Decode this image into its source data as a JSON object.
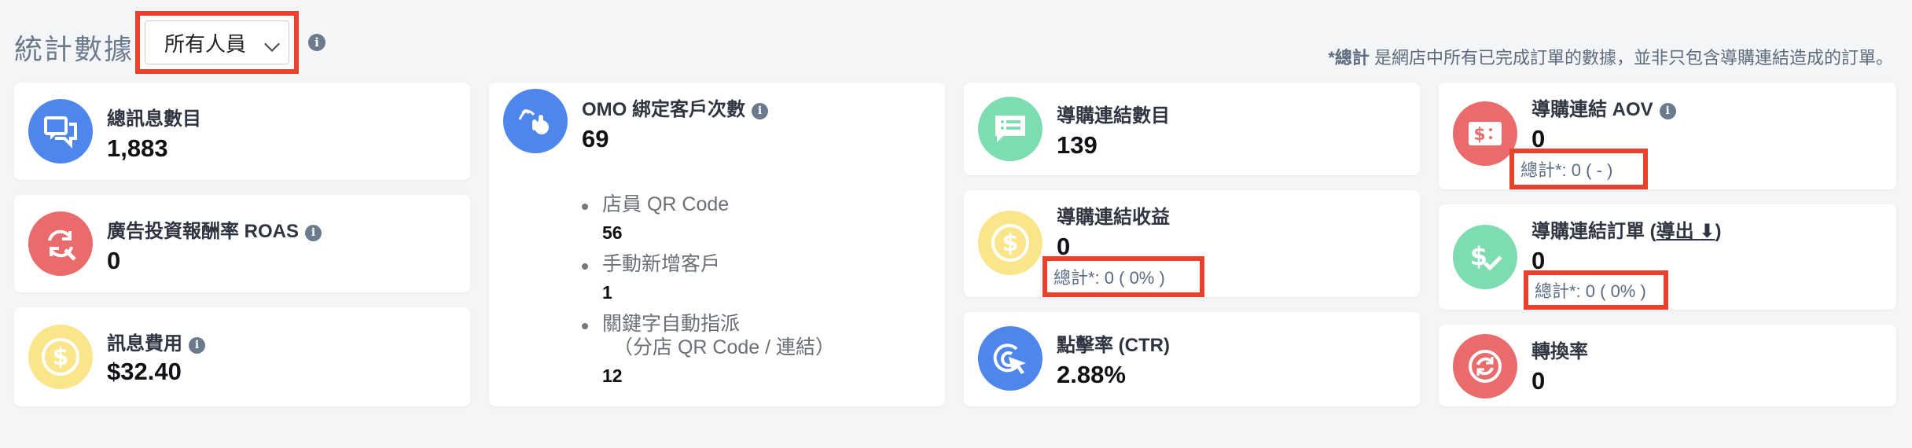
{
  "header": {
    "title": "統計數據",
    "staff_select_value": "所有人員",
    "note_bold": "*總計",
    "note_text": " 是網店中所有已完成訂單的數據，並非只包含導購連結造成的訂單。"
  },
  "cards": {
    "messages": {
      "title": "總訊息數目",
      "value": "1,883",
      "icon": "chat-bubbles-icon",
      "color": "#4f86ec"
    },
    "roas": {
      "title": "廣告投資報酬率 ROAS",
      "value": "0",
      "icon": "refresh-search-icon",
      "color": "#ea6b6b"
    },
    "message_cost": {
      "title": "訊息費用",
      "value": "$32.40",
      "icon": "dollar-icon",
      "color": "#fbe58a"
    },
    "omo": {
      "title": "OMO 綁定客戶次數",
      "value": "69",
      "icon": "hand-wave-icon",
      "color": "#4f86ec",
      "items": [
        {
          "label": "店員 QR Code",
          "sub": "",
          "value": "56"
        },
        {
          "label": "手動新增客戶",
          "sub": "",
          "value": "1"
        },
        {
          "label": "關鍵字自動指派",
          "sub": "（分店 QR Code / 連結）",
          "value": "12"
        }
      ]
    },
    "link_count": {
      "title": "導購連結數目",
      "value": "139",
      "icon": "list-bubble-icon",
      "color": "#7ddcb0"
    },
    "link_revenue": {
      "title": "導購連結收益",
      "value": "0",
      "total": "總計*: 0 ( 0% )",
      "icon": "dollar-icon",
      "color": "#fbe58a"
    },
    "ctr": {
      "title": "點擊率 (CTR)",
      "value": "2.88%",
      "icon": "cursor-click-icon",
      "color": "#4f86ec"
    },
    "aov": {
      "title": "導購連結 AOV",
      "value": "0",
      "total": "總計*: 0 ( - )",
      "icon": "ticket-dollar-icon",
      "color": "#ea6b6b"
    },
    "orders": {
      "title_prefix": "導購連結訂單 (",
      "export_label": "導出",
      "title_suffix": ")",
      "value": "0",
      "total": "總計*: 0 ( 0% )",
      "icon": "dollar-check-icon",
      "color": "#7ddcb0"
    },
    "conversion": {
      "title": "轉換率",
      "value": "0",
      "icon": "sync-icon",
      "color": "#ea6b6b"
    }
  }
}
